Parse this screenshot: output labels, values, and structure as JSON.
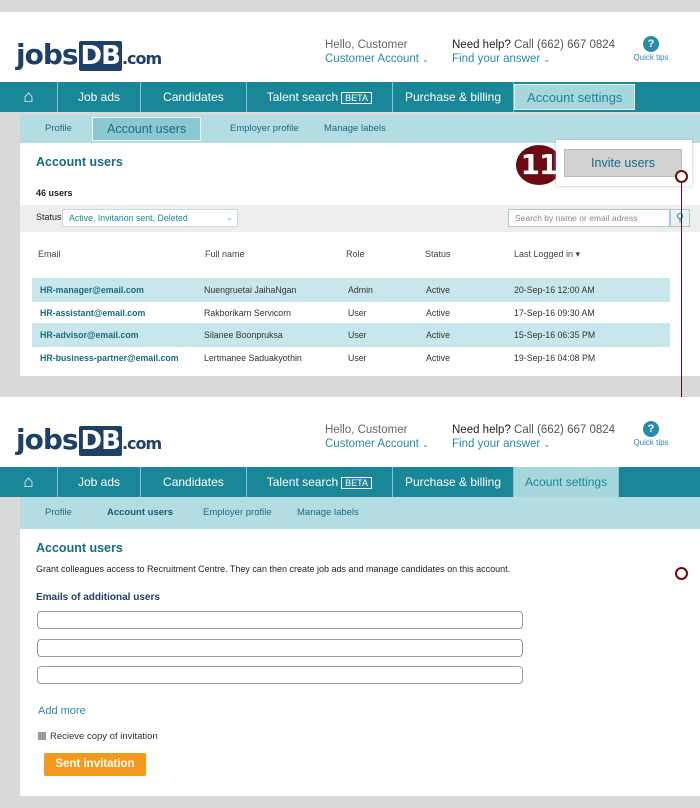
{
  "header": {
    "logo_jobs": "jobs",
    "logo_db": "DB",
    "logo_com": ".com",
    "greeting": "Hello, Customer",
    "account_link": "Customer Account",
    "help_label": "Need help?",
    "help_phone": "Call (662) 667 0824",
    "help_link": "Find your answer",
    "quick_tips": "Quick tips",
    "quick_tips_icon": "?"
  },
  "nav": {
    "home_icon": "⌂",
    "items": [
      "Job ads",
      "Candidates",
      "Talent search",
      "Purchase & billing",
      "Account settings",
      "Acount settings"
    ],
    "beta": "BETA"
  },
  "subnav": [
    "Profile",
    "Account users",
    "Employer profile",
    "Manage labels"
  ],
  "users_panel": {
    "title": "Account users",
    "step": "11",
    "invite_button": "Invite users",
    "count": "46 users",
    "status_label": "Status",
    "status_value": "Active, Invitarion sent, Deleted",
    "search_placeholder": "Search by name or email adress",
    "columns": [
      "Email",
      "Full name",
      "Role",
      "Status",
      "Last Logged in ▾"
    ],
    "rows": [
      {
        "email": "HR-manager@email.com",
        "name": "Nuengruetai JaihaNgan",
        "role": "Admin",
        "status": "Active",
        "last": "20-Sep-16  12:00 AM"
      },
      {
        "email": "HR-assistant@email.com",
        "name": "Rakborikarn Servicorn",
        "role": "User",
        "status": "Active",
        "last": "17-Sep-16  09:30 AM"
      },
      {
        "email": "HR-advisor@email.com",
        "name": "Silanee Boonpruksa",
        "role": "User",
        "status": "Active",
        "last": "15-Sep-16  06:35 PM"
      },
      {
        "email": "HR-business-partner@email.com",
        "name": "Lertmanee Saduakyothin",
        "role": "User",
        "status": "Active",
        "last": "19-Sep-16  04:08 PM"
      }
    ]
  },
  "invite_panel": {
    "title": "Account users",
    "description": "Grant colleagues access to Recruitment Centre. They can then create job ads and manage candidates on this account.",
    "emails_label": "Emails of additional users",
    "add_more": "Add more",
    "copy_checkbox": "Recieve copy of invitation",
    "send_button": "Sent invitation"
  },
  "colors": {
    "teal": "#1a8798",
    "accent": "#f39a1c",
    "badge": "#6b0a12",
    "navy": "#1e3f66"
  }
}
